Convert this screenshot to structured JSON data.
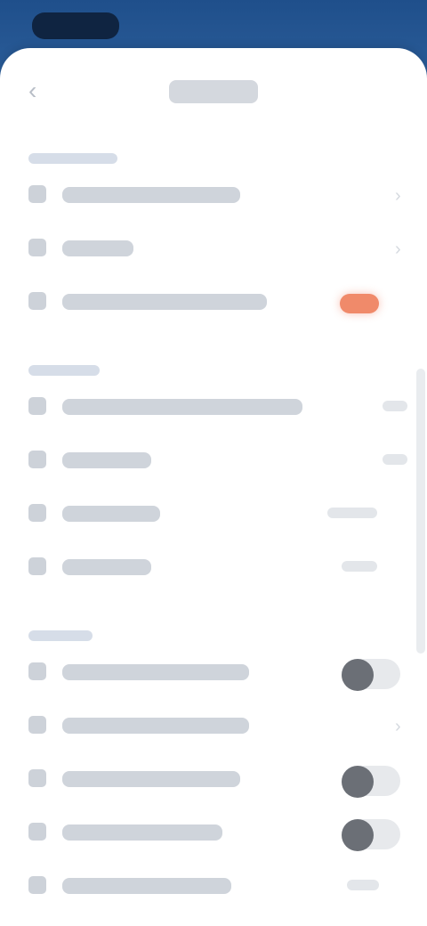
{
  "status_bar": {
    "time": ""
  },
  "header": {
    "title": ""
  },
  "sections": [
    {
      "header": "",
      "rows": [
        {
          "label": "",
          "value": "",
          "control": "chevron"
        },
        {
          "label": "",
          "value": "",
          "control": "chevron"
        },
        {
          "label": "",
          "value": "",
          "control": "badge"
        }
      ]
    },
    {
      "header": "",
      "rows": [
        {
          "label": "",
          "value": "",
          "control": "value"
        },
        {
          "label": "",
          "value": "",
          "control": "value"
        },
        {
          "label": "",
          "value": "",
          "control": "value"
        },
        {
          "label": "",
          "value": "",
          "control": "value"
        }
      ]
    },
    {
      "header": "",
      "rows": [
        {
          "label": "",
          "value": "",
          "control": "toggle",
          "on": false
        },
        {
          "label": "",
          "value": "",
          "control": "chevron"
        },
        {
          "label": "",
          "value": "",
          "control": "toggle",
          "on": false
        },
        {
          "label": "",
          "value": "",
          "control": "toggle",
          "on": false
        },
        {
          "label": "",
          "value": "",
          "control": "value"
        }
      ]
    }
  ],
  "colors": {
    "status_bar_bg": "#1f4f8b",
    "sheet_bg": "#ffffff",
    "badge": "#f08a6a",
    "toggle_knob": "#6b6f76"
  },
  "icons": {
    "back": "chevron-left-icon",
    "row": "setting-icon",
    "disclosure": "chevron-right-icon"
  }
}
